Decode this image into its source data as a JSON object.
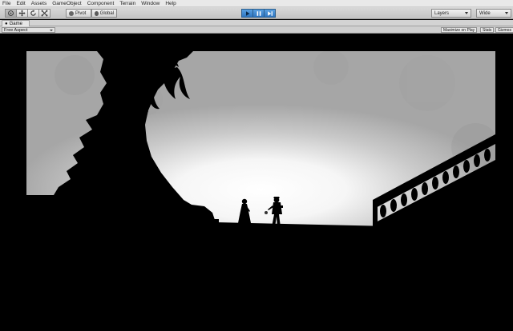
{
  "menu": {
    "items": [
      "File",
      "Edit",
      "Assets",
      "GameObject",
      "Component",
      "Terrain",
      "Window",
      "Help"
    ]
  },
  "toolbar": {
    "tools": [
      {
        "name": "hand-icon"
      },
      {
        "name": "move-icon"
      },
      {
        "name": "rotate-icon"
      },
      {
        "name": "scale-icon"
      }
    ],
    "pivot_label": "Pivot",
    "global_label": "Global",
    "layers_label": "Layers",
    "layout_label": "Wide",
    "play_color": "#3a83cf"
  },
  "game_tab": {
    "label": "Game"
  },
  "game_toolbar": {
    "aspect_label": "Free Aspect",
    "maximize_label": "Maximize on Play",
    "stats_label": "Stats",
    "gizmos_label": "Gizmos"
  }
}
